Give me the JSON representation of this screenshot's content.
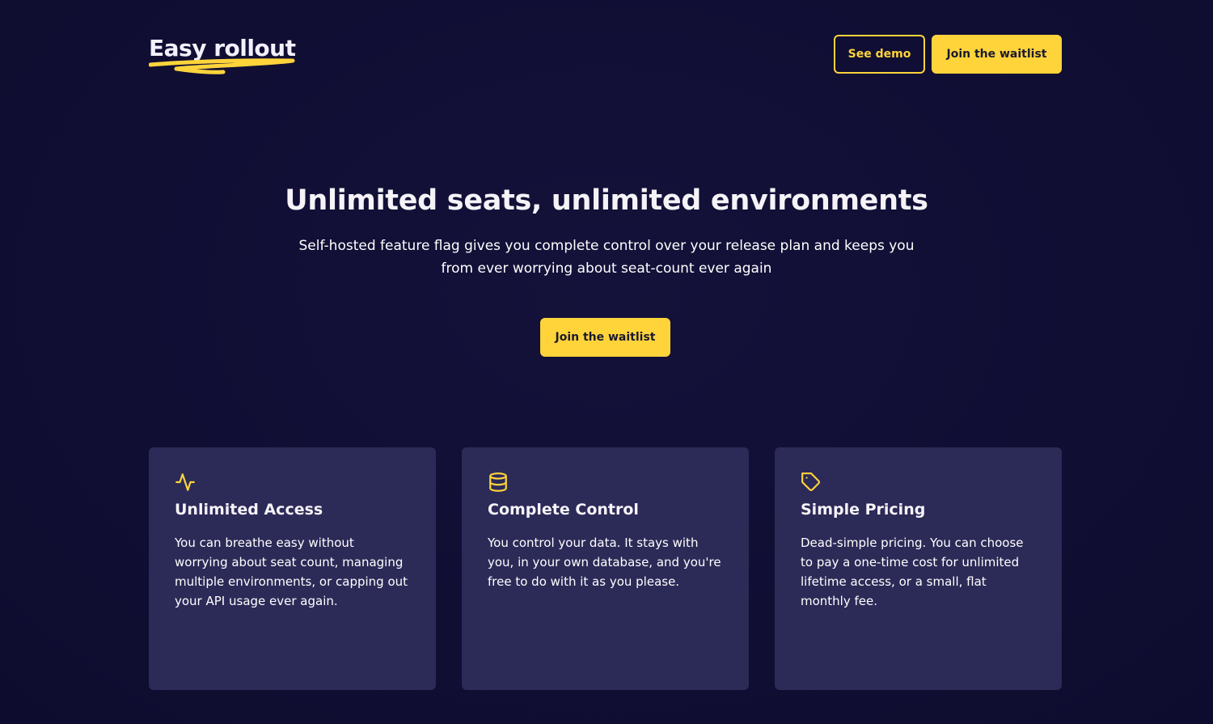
{
  "header": {
    "logo_text": "Easy rollout",
    "see_demo_label": "See demo",
    "join_waitlist_label": "Join the waitlist"
  },
  "hero": {
    "title": "Unlimited seats, unlimited environments",
    "subtitle": "Self-hosted feature flag gives you complete control over your release plan and keeps you from ever worrying about seat-count ever again",
    "cta_label": "Join the waitlist"
  },
  "features": [
    {
      "icon": "activity-icon",
      "title": "Unlimited Access",
      "text": "You can breathe easy without worrying about seat count, managing multiple environments, or capping out your API usage ever again."
    },
    {
      "icon": "database-icon",
      "title": "Complete Control",
      "text": "You control your data. It stays with you, in your own database, and you're free to do with it as you please."
    },
    {
      "icon": "tag-icon",
      "title": "Simple Pricing",
      "text": "Dead-simple pricing. You can choose to pay a one-time cost for unlimited lifetime access, or a small, flat monthly fee."
    }
  ],
  "colors": {
    "background": "#100e33",
    "accent": "#ffd43b",
    "card_background": "#2c2a57",
    "text": "#ffffff"
  }
}
